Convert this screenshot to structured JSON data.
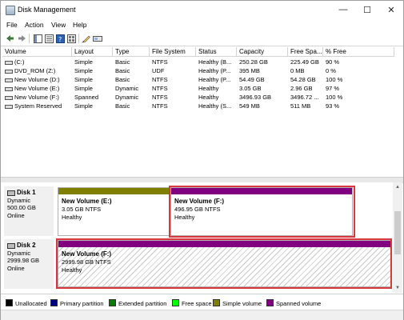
{
  "window": {
    "title": "Disk Management",
    "minimize": "—",
    "maximize": "☐",
    "close": "✕"
  },
  "menu": [
    "File",
    "Action",
    "View",
    "Help"
  ],
  "table": {
    "headers": [
      "Volume",
      "Layout",
      "Type",
      "File System",
      "Status",
      "Capacity",
      "Free Spa...",
      "% Free"
    ],
    "rows": [
      [
        "(C:)",
        "Simple",
        "Basic",
        "NTFS",
        "Healthy (B...",
        "250.28 GB",
        "225.49 GB",
        "90 %"
      ],
      [
        "DVD_ROM (Z:)",
        "Simple",
        "Basic",
        "UDF",
        "Healthy (P...",
        "395 MB",
        "0 MB",
        "0 %"
      ],
      [
        "New Volume (D:)",
        "Simple",
        "Basic",
        "NTFS",
        "Healthy (P...",
        "54.49 GB",
        "54.28 GB",
        "100 %"
      ],
      [
        "New Volume (E:)",
        "Simple",
        "Dynamic",
        "NTFS",
        "Healthy",
        "3.05 GB",
        "2.96 GB",
        "97 %"
      ],
      [
        "New Volume (F:)",
        "Spanned",
        "Dynamic",
        "NTFS",
        "Healthy",
        "3496.93 GB",
        "3496.72 ...",
        "100 %"
      ],
      [
        "System Reserved",
        "Simple",
        "Basic",
        "NTFS",
        "Healthy (S...",
        "549 MB",
        "511 MB",
        "93 %"
      ]
    ]
  },
  "disks": [
    {
      "name": "Disk 1",
      "type": "Dynamic",
      "size": "500.00 GB",
      "state": "Online",
      "volumes": [
        {
          "name": "New Volume  (E:)",
          "size": "3.05 GB NTFS",
          "status": "Healthy",
          "color": "#808000"
        },
        {
          "name": "New Volume  (F:)",
          "size": "496.95 GB NTFS",
          "status": "Healthy",
          "color": "#800080"
        }
      ]
    },
    {
      "name": "Disk 2",
      "type": "Dynamic",
      "size": "2999.98 GB",
      "state": "Online",
      "volumes": [
        {
          "name": "New Volume  (F:)",
          "size": "2999.98 GB NTFS",
          "status": "Healthy",
          "color": "#800080"
        }
      ]
    }
  ],
  "legend": [
    {
      "label": "Unallocated",
      "color": "#000000"
    },
    {
      "label": "Primary partition",
      "color": "#000080"
    },
    {
      "label": "Extended partition",
      "color": "#008000"
    },
    {
      "label": "Free space",
      "color": "#00ff00"
    },
    {
      "label": "Simple volume",
      "color": "#808000"
    },
    {
      "label": "Spanned volume",
      "color": "#800080"
    }
  ],
  "colors": {
    "selection": "#d9363e"
  }
}
